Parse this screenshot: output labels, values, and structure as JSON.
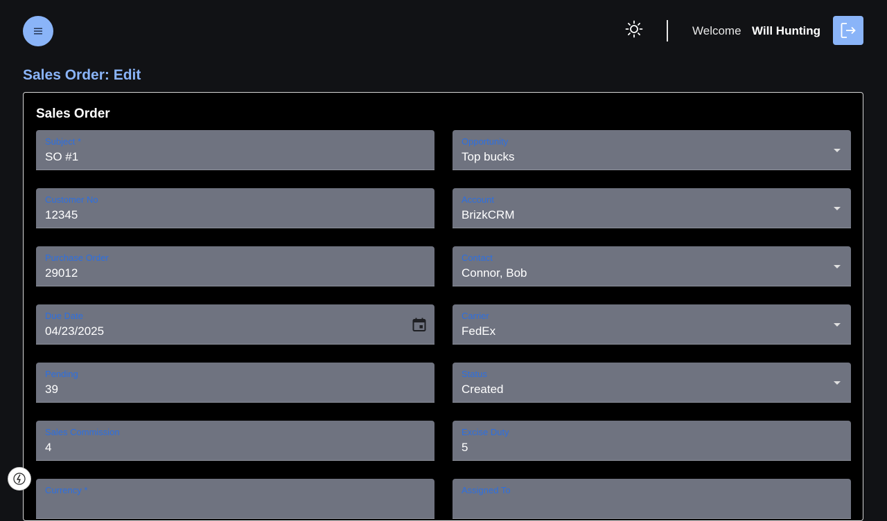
{
  "header": {
    "welcome_label": "Welcome",
    "user_name": "Will Hunting"
  },
  "page": {
    "title": "Sales Order: Edit"
  },
  "form": {
    "section_title": "Sales Order",
    "fields": {
      "subject": {
        "label": "Subject *",
        "value": "SO #1"
      },
      "opportunity": {
        "label": "Opportunity",
        "value": "Top bucks"
      },
      "customer_no": {
        "label": "Customer No",
        "value": "12345"
      },
      "account": {
        "label": "Account",
        "value": "BrizkCRM"
      },
      "purchase_order": {
        "label": "Purchase Order",
        "value": "29012"
      },
      "contact": {
        "label": "Contact",
        "value": "Connor, Bob"
      },
      "due_date": {
        "label": "Due Date",
        "value": "04/23/2025"
      },
      "carrier": {
        "label": "Carrier",
        "value": "FedEx"
      },
      "pending": {
        "label": "Pending",
        "value": "39"
      },
      "status": {
        "label": "Status",
        "value": "Created"
      },
      "sales_commission": {
        "label": "Sales Commission",
        "value": "4"
      },
      "excise_duty": {
        "label": "Excise Duty",
        "value": "5"
      },
      "currency": {
        "label": "Currency *",
        "value": ""
      },
      "assigned_to": {
        "label": "Assigned To",
        "value": ""
      }
    }
  },
  "colors": {
    "accent": "#8ab4f8",
    "field_label": "#2d6fe0",
    "field_bg": "#6f7380",
    "page_bg": "#111215",
    "card_bg": "#000000"
  },
  "icons": {
    "menu": "menu-icon",
    "theme": "sun-icon",
    "logout": "logout-icon",
    "calendar": "calendar-icon",
    "dropdown": "chevron-down-icon",
    "devtools": "lightning-icon"
  }
}
